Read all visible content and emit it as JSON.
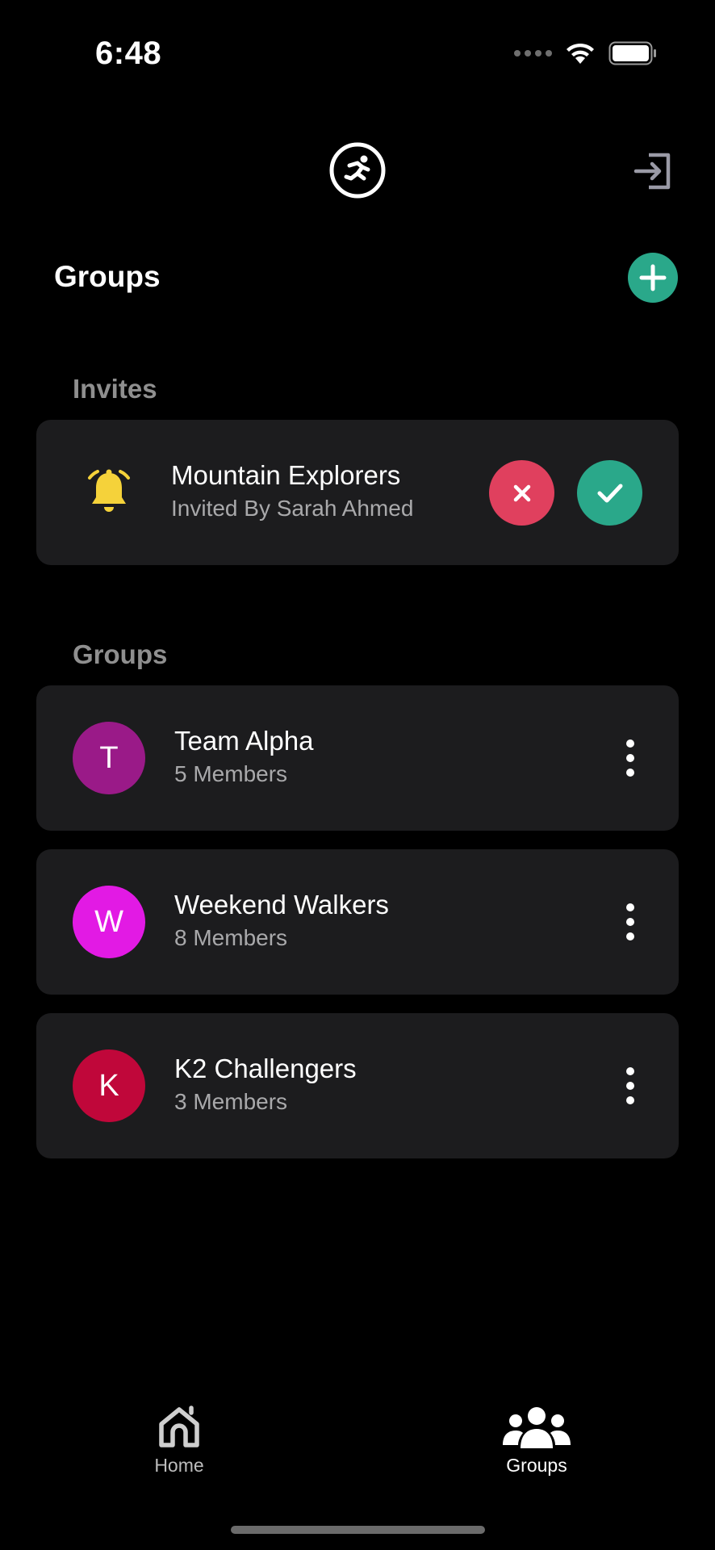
{
  "status_bar": {
    "time": "6:48"
  },
  "header": {
    "logo_icon": "runner-logo-icon",
    "logout_icon": "logout-icon"
  },
  "page": {
    "title": "Groups",
    "add_icon": "plus-icon"
  },
  "invites": {
    "section_label": "Invites",
    "items": [
      {
        "title": "Mountain Explorers",
        "subtitle": "Invited By Sarah Ahmed",
        "icon": "bell-icon"
      }
    ]
  },
  "groups": {
    "section_label": "Groups",
    "items": [
      {
        "initial": "T",
        "name": "Team Alpha",
        "members": "5 Members",
        "color": "#9a1a88"
      },
      {
        "initial": "W",
        "name": "Weekend Walkers",
        "members": "8 Members",
        "color": "#e21ae4"
      },
      {
        "initial": "K",
        "name": "K2 Challengers",
        "members": "3 Members",
        "color": "#c0073a"
      }
    ]
  },
  "bottom_nav": {
    "items": [
      {
        "label": "Home",
        "icon": "home-icon",
        "active": false
      },
      {
        "label": "Groups",
        "icon": "groups-icon",
        "active": true
      }
    ]
  },
  "colors": {
    "accent_green": "#2aa88a",
    "decline_red": "#e0405e",
    "bell_yellow": "#f5d23a",
    "card_bg": "#1c1c1e"
  }
}
